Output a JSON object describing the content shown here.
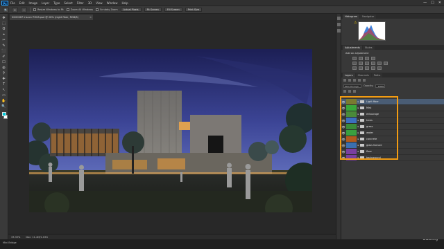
{
  "app": {
    "logo": "Ps",
    "menu": [
      "File",
      "Edit",
      "Image",
      "Layer",
      "Type",
      "Select",
      "Filter",
      "3D",
      "View",
      "Window",
      "Help"
    ],
    "window_controls": [
      "—",
      "□",
      "✕"
    ]
  },
  "options_bar": {
    "resize_windows": "Resize Windows to Fit",
    "zoom_all": "Zoom All Windows",
    "scrubby": "Scrubby Zoom",
    "buttons": [
      "Actual Pixels",
      "Fit Screen",
      "Fill Screen",
      "Print Size"
    ]
  },
  "tools": [
    "✥",
    "⬚",
    "ʘ",
    "⌖",
    "✂",
    "✎",
    "⬛",
    "✐",
    "☐",
    "◍",
    "⚲",
    "✚",
    "T",
    "↖",
    "▭",
    "✋",
    "🔍"
  ],
  "document": {
    "tab_title": "DC00067 Inscon P.RGS.psd @ 28% (night fiber, RGB/8)",
    "close": "×",
    "zoom": "33.33%",
    "doc_size": "Doc: 11.4M/1.03G"
  },
  "mini_bridge": "Mini Bridge",
  "watermark": "udemy",
  "histogram": {
    "tabs": [
      "Histogram",
      "Navigator"
    ],
    "warning": "⚠"
  },
  "adjustments": {
    "tabs": [
      "Adjustments",
      "Styles"
    ],
    "title": "Add an adjustment"
  },
  "layers": {
    "tabs": [
      "Layers",
      "Channels",
      "Paths"
    ],
    "kind_filter": "Pass Through",
    "opacity_label": "Opacity:",
    "opacity_value": "100%",
    "items": [
      {
        "name": "Light fiber",
        "color": "#7a7a30"
      },
      {
        "name": "Mist",
        "color": "#3aa63a"
      },
      {
        "name": "entourage",
        "color": "#4a8a3a"
      },
      {
        "name": "trees",
        "color": "#3b6fbf"
      },
      {
        "name": "grass",
        "color": "#3a8a3a"
      },
      {
        "name": "water",
        "color": "#3aa040"
      },
      {
        "name": "concrete",
        "color": "#b05a1e"
      },
      {
        "name": "glass facture",
        "color": "#3a6fb0"
      },
      {
        "name": "floor",
        "color": "#7a3fa0"
      },
      {
        "name": "background",
        "color": "#7a3fa0"
      }
    ]
  },
  "colors": {
    "highlight": "#f39c12",
    "selected_row": "#4a5d75"
  }
}
